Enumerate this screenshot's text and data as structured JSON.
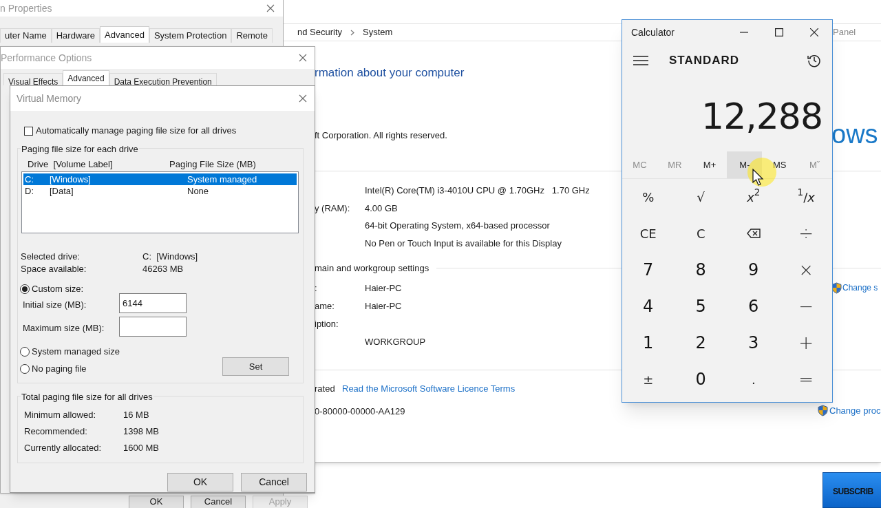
{
  "system_properties": {
    "title": "n Properties",
    "tabs": [
      {
        "label": "uter Name",
        "selected": false
      },
      {
        "label": "Hardware",
        "selected": false
      },
      {
        "label": "Advanced",
        "selected": true
      },
      {
        "label": "System Protection",
        "selected": false
      },
      {
        "label": "Remote",
        "selected": false
      }
    ],
    "buttons": [
      {
        "label": "OK",
        "disabled": false
      },
      {
        "label": "Cancel",
        "disabled": false
      },
      {
        "label": "Apply",
        "disabled": true
      }
    ]
  },
  "control_panel": {
    "breadcrumb": [
      "nd Security",
      "System"
    ],
    "breadcrumb_right": "Panel",
    "heading": "rmation about your computer",
    "brand": "ows",
    "copyright": "ft Corporation. All rights reserved.",
    "system_rows": [
      {
        "value": "Intel(R) Core(TM) i3-4010U CPU @ 1.70GHz   1.70 GHz"
      },
      {
        "label": "y (RAM):",
        "value": "4.00 GB"
      },
      {
        "value": "64-bit Operating System, x64-based processor"
      },
      {
        "value": "No Pen or Touch Input is available for this Display"
      }
    ],
    "domain_title": "main and workgroup settings",
    "domain_rows": [
      {
        "label": ":",
        "value": "Haier-PC"
      },
      {
        "label": "ame:",
        "value": "Haier-PC"
      },
      {
        "label": "iption:"
      },
      {
        "value": "WORKGROUP"
      }
    ],
    "change_settings": "Change s",
    "activation": "rated",
    "license_link": "Read the Microsoft Software Licence Terms",
    "product_id": "0-80000-00000-AA129",
    "change_product": "Change proc"
  },
  "performance_options": {
    "title": "Performance Options",
    "tabs": [
      {
        "label": "Visual Effects",
        "selected": false
      },
      {
        "label": "Advanced",
        "selected": true
      },
      {
        "label": "Data Execution Prevention",
        "selected": false
      }
    ]
  },
  "virtual_memory": {
    "title": "Virtual Memory",
    "auto_manage": {
      "label": "Automatically manage paging file size for all drives",
      "checked": false
    },
    "group_title": "Paging file size for each drive",
    "columns": [
      "Drive  [Volume Label]",
      "Paging File Size (MB)"
    ],
    "drives": [
      {
        "drive": "C:",
        "volume": "[Windows]",
        "size": "System managed",
        "selected": true
      },
      {
        "drive": "D:",
        "volume": "[Data]",
        "size": "None",
        "selected": false
      }
    ],
    "info": [
      {
        "label": "Selected drive:",
        "value": "C:  [Windows]"
      },
      {
        "label": "Space available:",
        "value": "46263 MB"
      }
    ],
    "options": [
      {
        "label": "Custom size:",
        "selected": true
      },
      {
        "label": "System managed size",
        "selected": false
      },
      {
        "label": "No paging file",
        "selected": false
      }
    ],
    "initial_size": {
      "label": "Initial size (MB):",
      "value": "6144"
    },
    "maximum_size": {
      "label": "Maximum size (MB):"
    },
    "set_button": "Set",
    "totals_title": "Total paging file size for all drives",
    "totals": [
      {
        "label": "Minimum allowed:",
        "value": "16 MB"
      },
      {
        "label": "Recommended:",
        "value": "1398 MB"
      },
      {
        "label": "Currently allocated:",
        "value": "1600 MB"
      }
    ],
    "buttons": [
      "OK",
      "Cancel"
    ]
  },
  "calculator": {
    "title": "Calculator",
    "mode": "STANDARD",
    "display": "12,288",
    "memory": [
      {
        "label": "MC",
        "disabled": true,
        "hovered": false
      },
      {
        "label": "MR",
        "disabled": true,
        "hovered": false
      },
      {
        "label": "M+",
        "disabled": false,
        "hovered": false
      },
      {
        "label": "M-",
        "disabled": false,
        "hovered": true
      },
      {
        "label": "MS",
        "disabled": false,
        "hovered": false
      },
      {
        "label": "Mˇ",
        "disabled": true,
        "hovered": false
      }
    ],
    "keys": [
      {
        "kind": "function",
        "label": "%"
      },
      {
        "kind": "function",
        "label": "√"
      },
      {
        "kind": "function",
        "label": "*x*$^{2}$"
      },
      {
        "kind": "function",
        "label": "$^{1}$/*x*"
      },
      {
        "kind": "function",
        "label": "CE"
      },
      {
        "kind": "function",
        "label": "C"
      },
      {
        "kind": "backspace"
      },
      {
        "kind": "operator",
        "label": "÷"
      },
      {
        "kind": "digit",
        "label": "7"
      },
      {
        "kind": "digit",
        "label": "8"
      },
      {
        "kind": "digit",
        "label": "9"
      },
      {
        "kind": "operator",
        "label": "×"
      },
      {
        "kind": "digit",
        "label": "4"
      },
      {
        "kind": "digit",
        "label": "5"
      },
      {
        "kind": "digit",
        "label": "6"
      },
      {
        "kind": "operator",
        "label": "−"
      },
      {
        "kind": "digit",
        "label": "1"
      },
      {
        "kind": "digit",
        "label": "2"
      },
      {
        "kind": "digit",
        "label": "3"
      },
      {
        "kind": "operator",
        "label": "+"
      },
      {
        "kind": "function",
        "label": "±"
      },
      {
        "kind": "digit",
        "label": "0"
      },
      {
        "kind": "function",
        "label": "."
      },
      {
        "kind": "operator",
        "label": "="
      }
    ]
  },
  "subscribe": "SUBSCRIB"
}
